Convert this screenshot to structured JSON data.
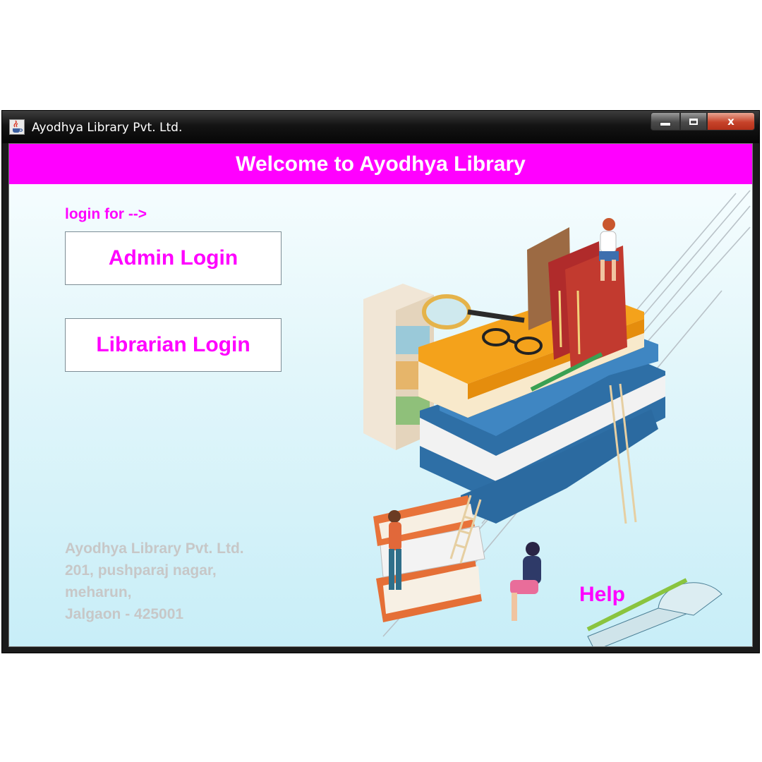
{
  "window": {
    "title": "Ayodhya Library Pvt. Ltd.",
    "app_icon": "java-cup-icon",
    "controls": {
      "minimize": "minimize-icon",
      "maximize": "maximize-icon",
      "close": "x"
    }
  },
  "banner": {
    "title": "Welcome to Ayodhya Library"
  },
  "login": {
    "prompt": "login for -->",
    "admin_label": "Admin Login",
    "librarian_label": "Librarian Login"
  },
  "address": {
    "lines": [
      "Ayodhya Library Pvt. Ltd.",
      "201, pushparaj nagar,",
      "meharun,",
      "Jalgaon - 425001"
    ]
  },
  "help_label": "Help",
  "colors": {
    "accent": "#ff00ff",
    "banner_text": "#ffffff",
    "address_text": "#c7c7c7",
    "background_top": "#f9feff",
    "background_bottom": "#c8eef8"
  },
  "illustration": {
    "subject": "books-stack-with-people-illustration"
  }
}
